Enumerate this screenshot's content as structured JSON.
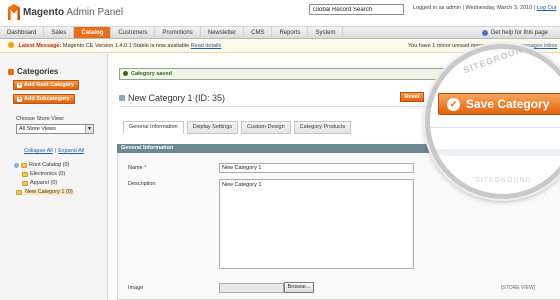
{
  "header": {
    "logo_brand": "Magento",
    "logo_suffix": "Admin Panel",
    "search_value": "Global Record Search",
    "user_info": "Logged in as admin  |  Wednesday, March 3, 2010  |",
    "logout": "Log Out"
  },
  "nav": {
    "items": [
      "Dashboard",
      "Sales",
      "Catalog",
      "Customers",
      "Promotions",
      "Newsletter",
      "CMS",
      "Reports",
      "System"
    ],
    "active": "Catalog",
    "help": "Get help for this page"
  },
  "message": {
    "title": "Latest Message:",
    "text": "Magento CE Version 1.4.0.1 Stable is now available",
    "link": "Read details",
    "right_text": "You have 1 minor unread message(s).",
    "right_link": "Go to messages inbox"
  },
  "sidebar": {
    "title": "Categories",
    "add_root": "Add Root Category",
    "add_sub": "Add Subcategory",
    "choose_store": "Choose Store View:",
    "store_value": "All Store Views",
    "collapse": "Collapse All",
    "separator": "|",
    "expand": "Expand All",
    "tree": [
      {
        "label": "Root Catalog (0)"
      },
      {
        "label": "Electronics (0)"
      },
      {
        "label": "Apparel (0)"
      },
      {
        "label": "New Category 1 (0)"
      }
    ]
  },
  "main": {
    "saved_message": "Category saved",
    "title": "New Category 1 (ID: 35)",
    "reset": "Reset",
    "tabs": [
      "General Information",
      "Display Settings",
      "Custom Design",
      "Category Products"
    ],
    "active_tab": "General Information",
    "section_title": "General Information",
    "name_label": "Name",
    "name_required": "*",
    "name_value": "New Category 1",
    "description_label": "Description",
    "description_value": "New Category 1",
    "image_label": "Image",
    "browse": "Browse...",
    "store_view_tag": "[STORE VIEW]"
  },
  "magnifier": {
    "watermark": "SITEGROUND.COM",
    "watermark2": "SITEGROUND",
    "save_button": "Save Category"
  },
  "colors": {
    "accent": "#e86e1c",
    "section_head": "#6f8992"
  }
}
